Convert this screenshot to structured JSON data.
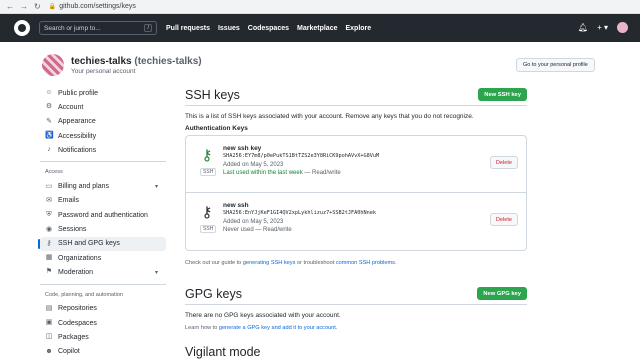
{
  "browser": {
    "url": "github.com/settings/keys"
  },
  "header": {
    "search_placeholder": "Search or jump to...",
    "search_shortcut": "/",
    "nav": [
      "Pull requests",
      "Issues",
      "Codespaces",
      "Marketplace",
      "Explore"
    ],
    "plus_label": "+ ▾"
  },
  "profile": {
    "name": "techies-talks",
    "handle": "(techies-talks)",
    "subtitle": "Your personal account",
    "go_button": "Go to your personal profile"
  },
  "sidebar": {
    "items_top": [
      {
        "label": "Public profile",
        "icon": "person-icon"
      },
      {
        "label": "Account",
        "icon": "gear-icon"
      },
      {
        "label": "Appearance",
        "icon": "paintbrush-icon"
      },
      {
        "label": "Accessibility",
        "icon": "accessibility-icon"
      },
      {
        "label": "Notifications",
        "icon": "bell-icon"
      }
    ],
    "access_heading": "Access",
    "items_access": [
      {
        "label": "Billing and plans",
        "icon": "credit-card-icon",
        "chevron": true
      },
      {
        "label": "Emails",
        "icon": "mail-icon"
      },
      {
        "label": "Password and authentication",
        "icon": "shield-lock-icon"
      },
      {
        "label": "Sessions",
        "icon": "broadcast-icon"
      },
      {
        "label": "SSH and GPG keys",
        "icon": "key-icon",
        "active": true
      },
      {
        "label": "Organizations",
        "icon": "organization-icon"
      },
      {
        "label": "Moderation",
        "icon": "report-icon",
        "chevron": true
      }
    ],
    "code_heading": "Code, planning, and automation",
    "items_code": [
      {
        "label": "Repositories",
        "icon": "repo-icon"
      },
      {
        "label": "Codespaces",
        "icon": "codespaces-icon"
      },
      {
        "label": "Packages",
        "icon": "package-icon"
      },
      {
        "label": "Copilot",
        "icon": "copilot-icon"
      }
    ]
  },
  "ssh": {
    "title": "SSH keys",
    "new_button": "New SSH key",
    "intro": "This is a list of SSH keys associated with your account. Remove any keys that you do not recognize.",
    "auth_heading": "Authentication Keys",
    "keys": [
      {
        "title": "new ssh key",
        "fingerprint": "SHA256:EY7m8/p0ePukTS1BtTZS2e3Y8RiCK9pohAVvX+G8VuM",
        "added": "Added on May 5, 2023",
        "used_recent": "Last used within the last week",
        "used_rest": " — Read/write",
        "badge": "SSH",
        "delete": "Delete",
        "recent": true
      },
      {
        "title": "new ssh",
        "fingerprint": "SHA256:EnYJjKeF1GI4QV2xpLykhlizuz7+SSB2tJFA0hNnek",
        "added": "Added on May 5, 2023",
        "used_recent": "",
        "used_rest": "Never used — Read/write",
        "badge": "SSH",
        "delete": "Delete",
        "recent": false
      }
    ],
    "guide_pre": "Check out our guide to ",
    "guide_link1": "generating SSH keys",
    "guide_mid": " or troubleshoot ",
    "guide_link2": "common SSH problems",
    "guide_post": "."
  },
  "gpg": {
    "title": "GPG keys",
    "new_button": "New GPG key",
    "empty": "There are no GPG keys associated with your account.",
    "learn_pre": "Learn how to ",
    "learn_link": "generate a GPG key and add it to your account",
    "learn_post": "."
  },
  "vigilant": {
    "title": "Vigilant mode"
  }
}
